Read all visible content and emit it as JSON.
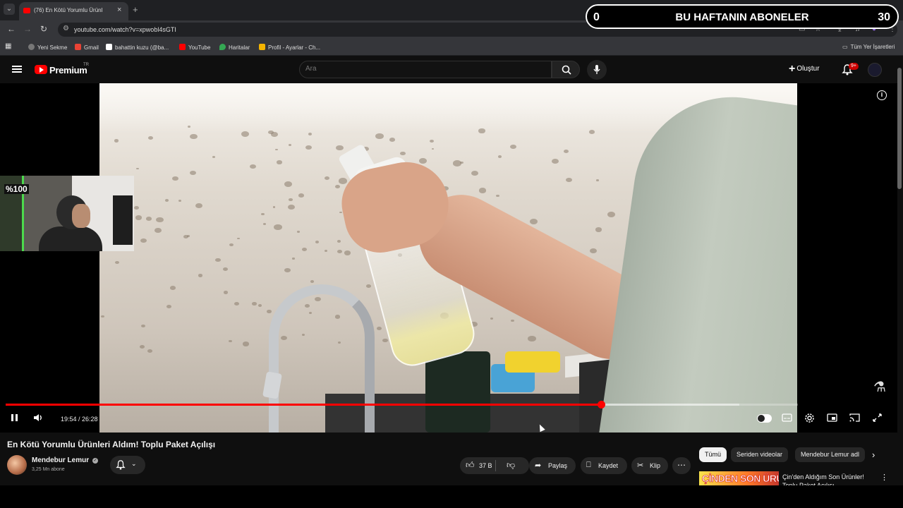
{
  "browser": {
    "tab": {
      "title": "(76) En Kötü Yorumlu Ürünl",
      "favicon": "youtube-favicon",
      "audio_icon": "speaker-icon",
      "close": "×"
    },
    "new_tab": "+",
    "url": "youtube.com/watch?v=xpwobl4sGTI",
    "bookmarks": [
      {
        "label": "Yeni Sekme",
        "icon": "globe-icon",
        "color": "#888888"
      },
      {
        "label": "Gmail",
        "icon": "gmail-icon",
        "color": "#ea4335"
      },
      {
        "label": "bahattin kuzu (@ba...",
        "icon": "x-icon",
        "color": "#ffffff"
      },
      {
        "label": "YouTube",
        "icon": "youtube-icon",
        "color": "#ff0000"
      },
      {
        "label": "Haritalar",
        "icon": "maps-icon",
        "color": "#34a853"
      },
      {
        "label": "Profil - Ayarlar - Ch...",
        "icon": "profile-icon",
        "color": "#f4b400"
      }
    ],
    "all_bookmarks": "Tüm Yer İşaretleri"
  },
  "overlay": {
    "left_count": "0",
    "label": "BU HAFTANIN ABONELER",
    "right_count": "30"
  },
  "header": {
    "brand": "Premium",
    "brand_sup": "TR",
    "search_placeholder": "Ara",
    "create_label": "Oluştur",
    "notification_badge": "9+"
  },
  "player": {
    "current_time": "19:54",
    "duration": "26:28",
    "time_label": "19:54 / 26:28",
    "played_fraction": 0.752,
    "webcam_logo": "%100"
  },
  "video": {
    "title": "En Kötü Yorumlu Ürünleri Aldım! Toplu Paket Açılışı",
    "channel": "Mendebur Lemur",
    "subscribers": "3,25 Mn abone",
    "likes": "37 B",
    "share": "Paylaş",
    "save": "Kaydet",
    "clip": "Klip"
  },
  "sidebar": {
    "chips": [
      "Tümü",
      "Seriden videolar",
      "Mendebur Lemur adl"
    ],
    "rec_thumb_text": "ÇİNDEN SON ÜRÜNLER",
    "rec_title": "Çin'den Aldığım Son Ürünler! Toplu Paket Açılışı"
  },
  "colors": {
    "accent": "#ff0000",
    "background": "#0f0f0f"
  }
}
